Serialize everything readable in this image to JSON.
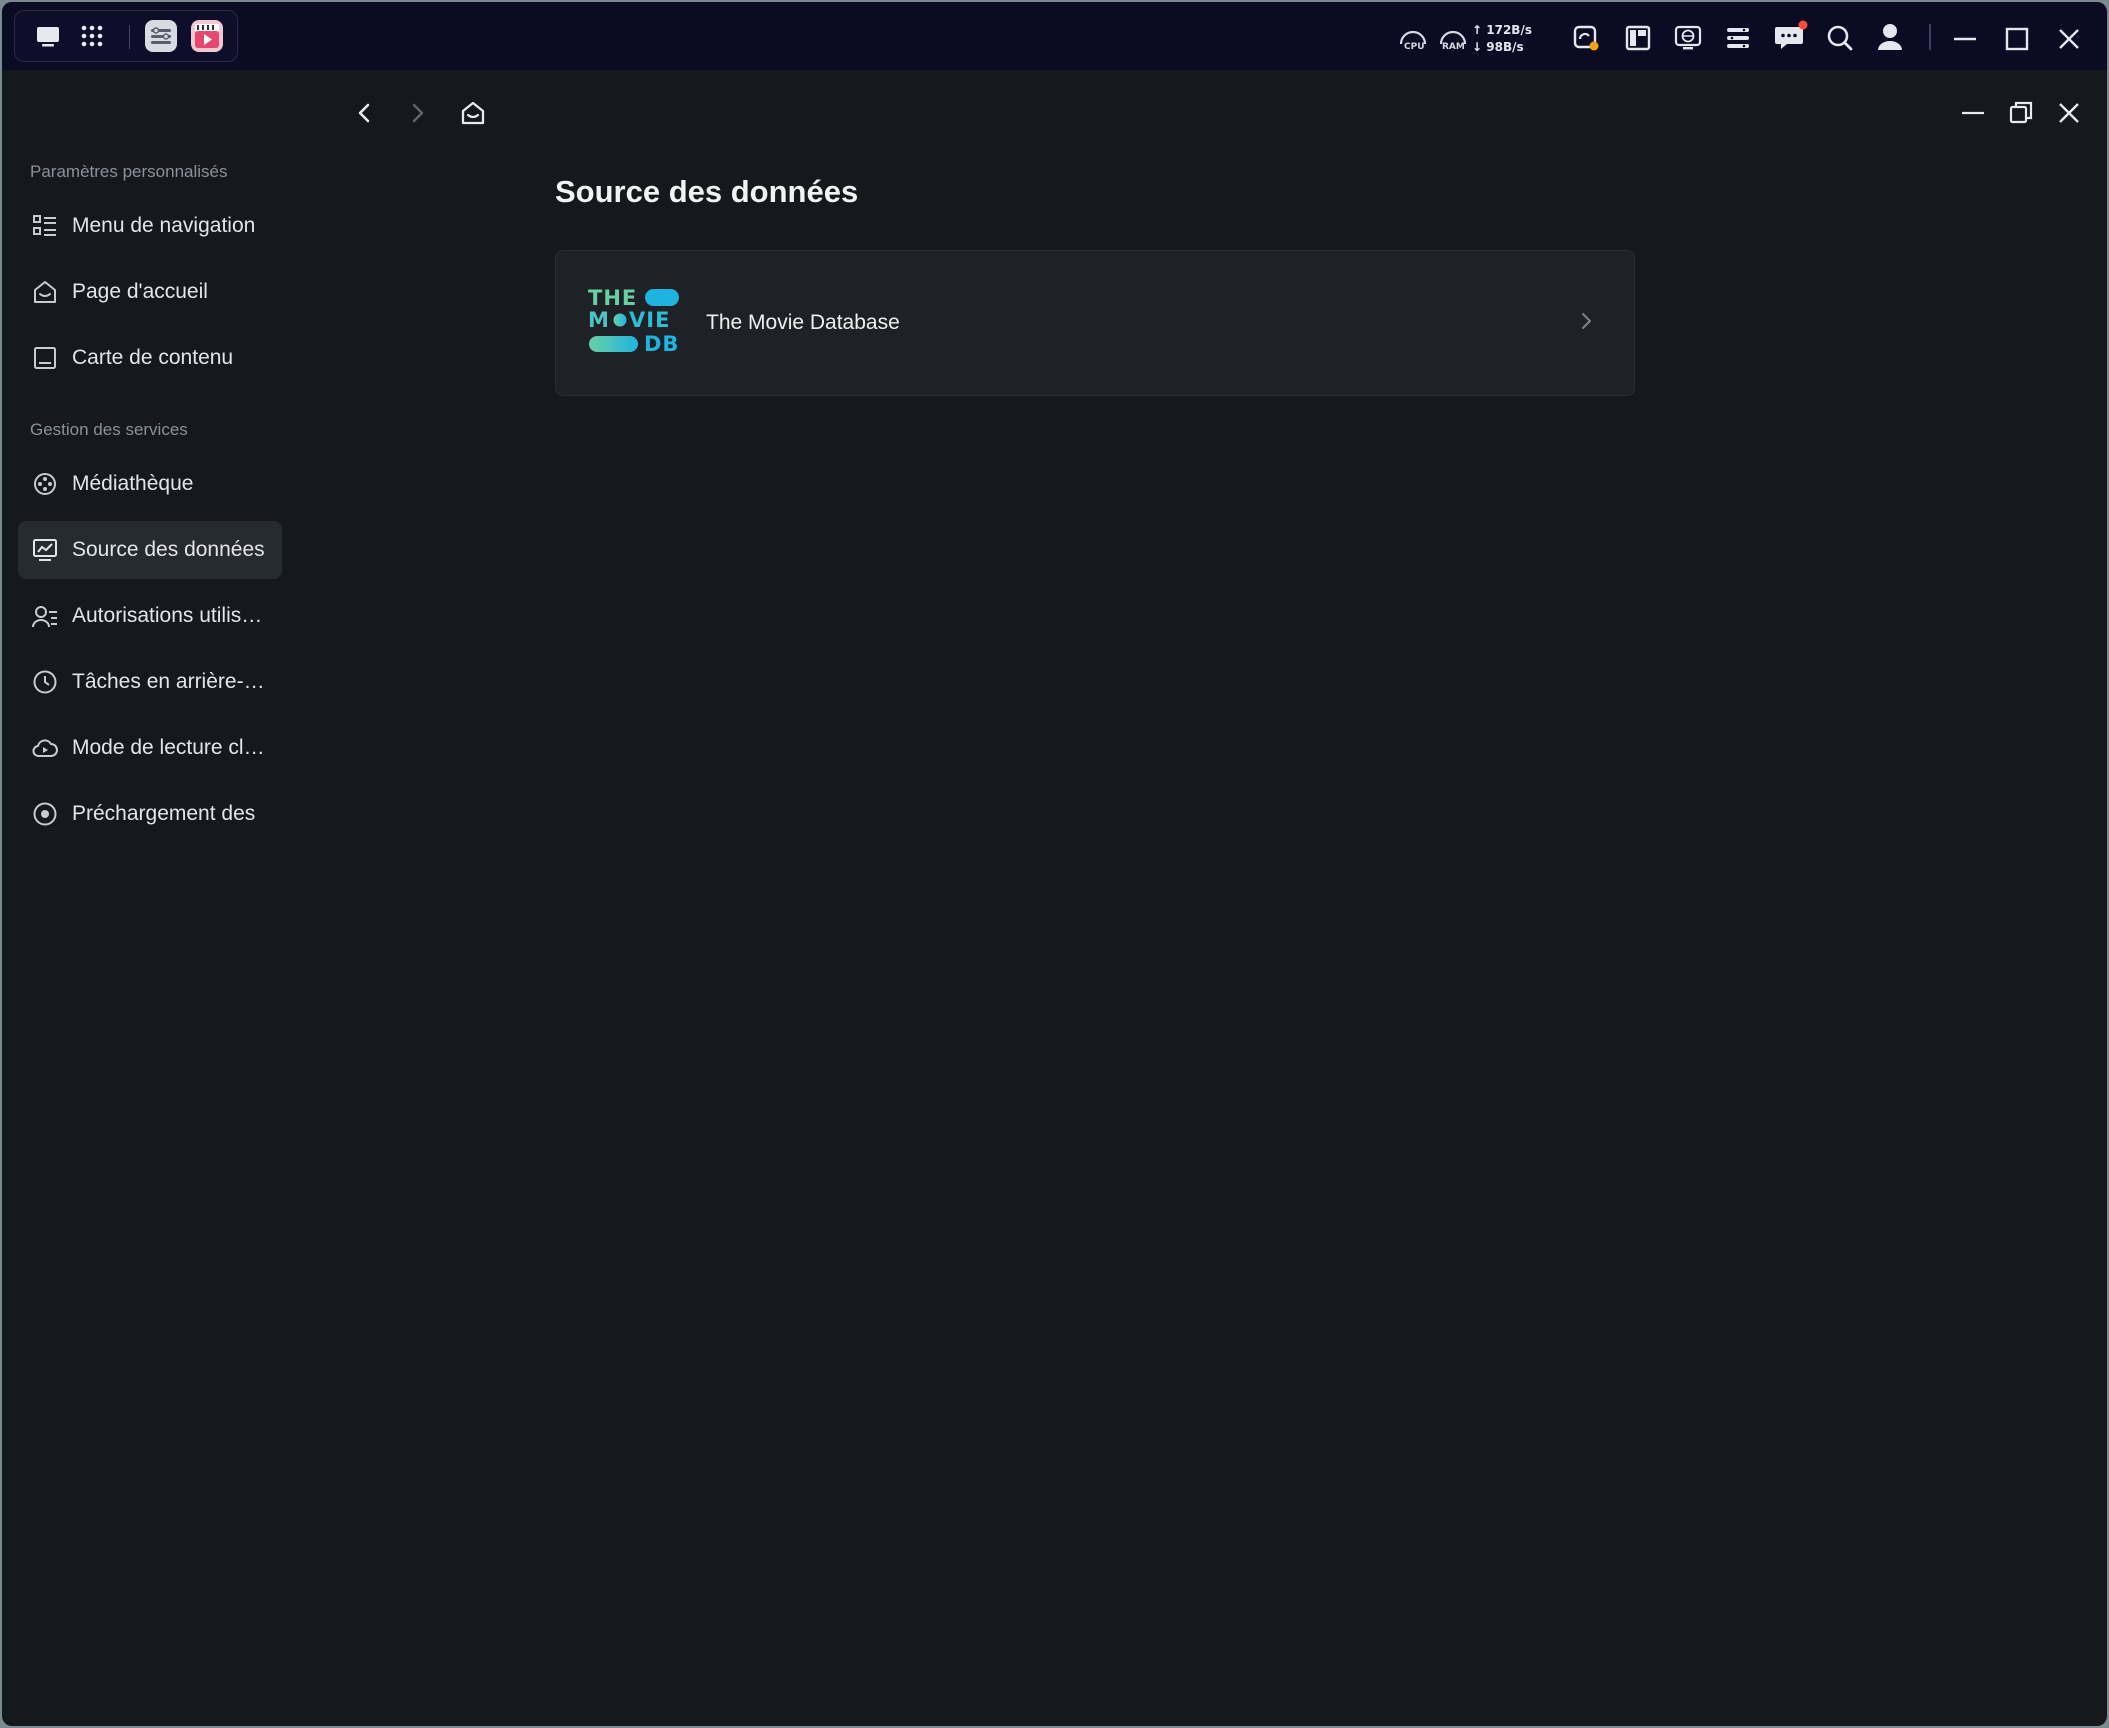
{
  "system_bar": {
    "cpu_label": "CPU",
    "ram_label": "RAM",
    "upload": "172B/s",
    "download": "98B/s",
    "arrow_up": "↑",
    "arrow_down": "↓"
  },
  "sidebar": {
    "group1_title": "Paramètres personnalisés",
    "group1_items": [
      {
        "label": "Menu de navigation",
        "icon": "list-icon"
      },
      {
        "label": "Page d'accueil",
        "icon": "home-icon"
      },
      {
        "label": "Carte de contenu",
        "icon": "card-icon"
      }
    ],
    "group2_title": "Gestion des services",
    "group2_items": [
      {
        "label": "Médiathèque",
        "icon": "media-library-icon"
      },
      {
        "label": "Source des données",
        "icon": "data-source-icon",
        "active": true
      },
      {
        "label": "Autorisations utilisateur",
        "icon": "user-permissions-icon"
      },
      {
        "label": "Tâches en arrière-plan",
        "icon": "clock-icon"
      },
      {
        "label": "Mode de lecture cloud",
        "icon": "cloud-play-icon"
      },
      {
        "label": "Préchargement des",
        "icon": "preload-icon"
      }
    ]
  },
  "main": {
    "title": "Source des données",
    "sources": [
      {
        "name": "The Movie Database",
        "logo_text": [
          "THE",
          "M",
          "VIE",
          "DB"
        ]
      }
    ]
  },
  "colors": {
    "accent_blue": "#1fb4e0",
    "accent_green": "#6ad0a4",
    "notification_red": "#ff4a3d",
    "badge_orange": "#f2a31b"
  }
}
